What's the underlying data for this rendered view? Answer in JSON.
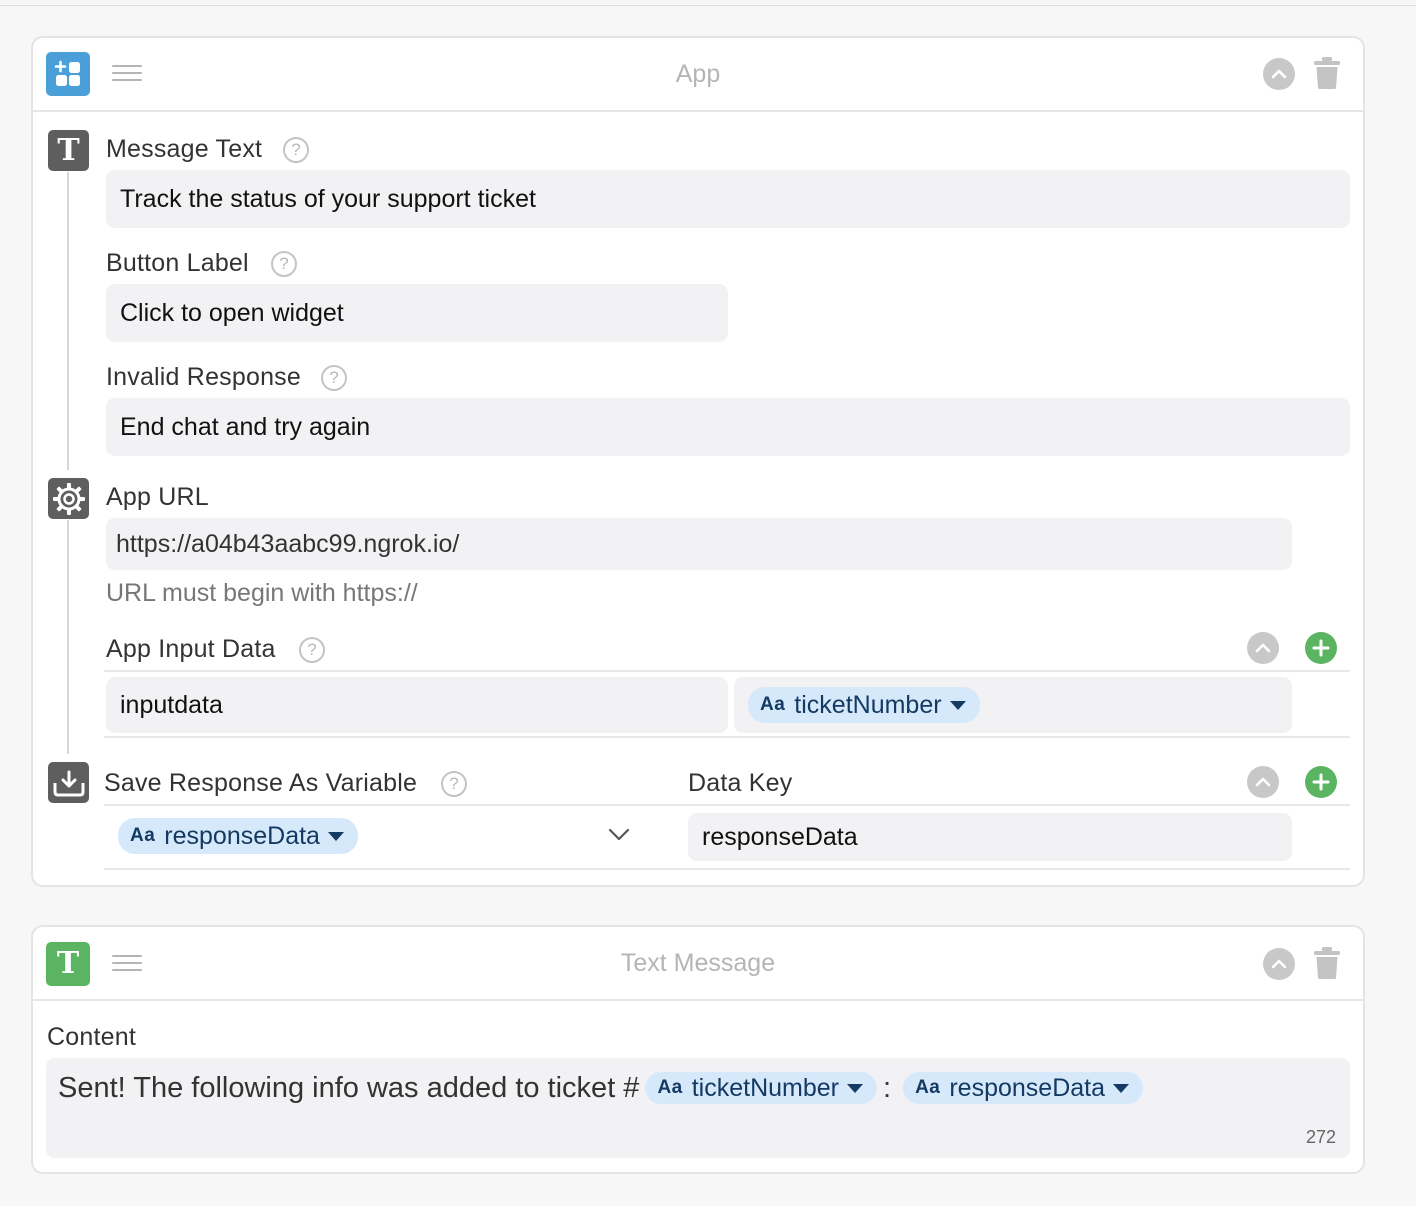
{
  "app_card": {
    "title": "App",
    "message_text": {
      "label": "Message Text",
      "value": "Track the status of your support ticket"
    },
    "button_label": {
      "label": "Button Label",
      "value": "Click to open widget"
    },
    "invalid_response": {
      "label": "Invalid Response",
      "value": "End chat and try again"
    },
    "app_url": {
      "label": "App URL",
      "value": "https://a04b43aabc99.ngrok.io/",
      "hint": "URL must begin with https://"
    },
    "app_input_data": {
      "label": "App Input Data",
      "key": "inputdata",
      "variable": "ticketNumber"
    },
    "save_response": {
      "label": "Save Response As Variable",
      "variable": "responseData",
      "data_key_label": "Data Key",
      "data_key_value": "responseData"
    }
  },
  "text_card": {
    "title": "Text Message",
    "content_label": "Content",
    "content_text": "Sent! The following info was added to ticket #",
    "var1": "ticketNumber",
    "separator": ":",
    "var2": "responseData",
    "char_count": "272"
  },
  "chip_prefix": "Aa",
  "help_glyph": "?",
  "colors": {
    "app_icon": "#4a9fd8",
    "text_icon": "#5bb462",
    "chip_bg": "#d6e9fb",
    "add_button": "#5bb462"
  }
}
